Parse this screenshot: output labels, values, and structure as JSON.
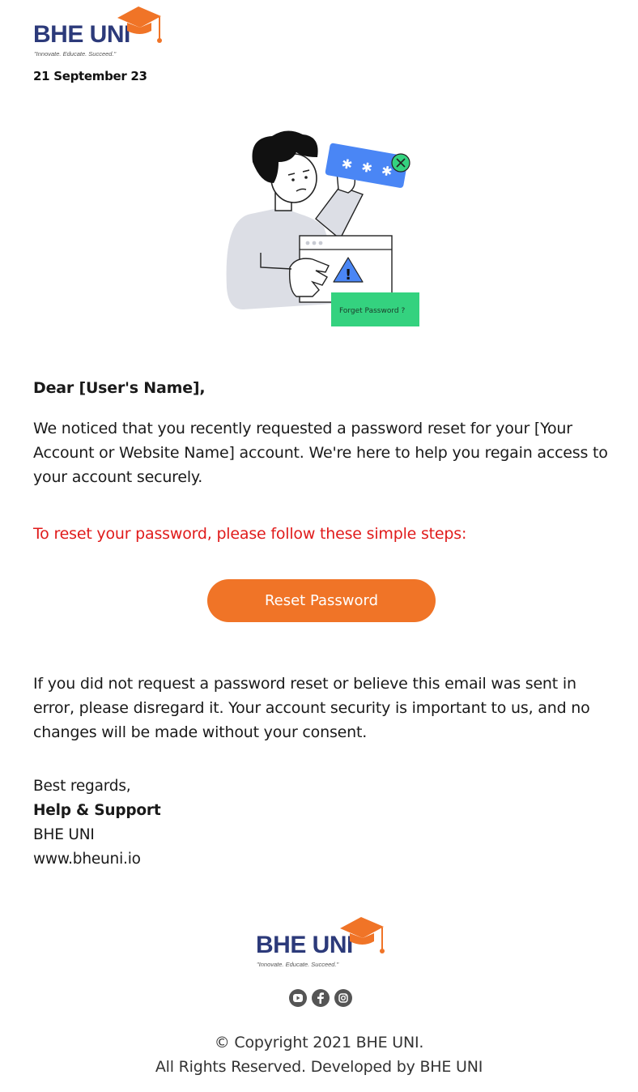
{
  "brand": {
    "name": "BHE UNI",
    "tagline": "\"Innovate. Educate. Succeed.\""
  },
  "email": {
    "date": "21 September 23",
    "illustration_label": "Forget Password ?",
    "greeting": "Dear [User's Name],",
    "intro": "We noticed that you recently requested a password reset for your [Your Account or Website Name] account. We're here to help you regain access to your account securely.",
    "steps_text": "To reset your password, please follow these simple steps:",
    "button_label": "Reset Password",
    "disclaimer": "If you did not request a password reset or believe this email was sent in error, please disregard it. Your account security is important to us, and no changes will be made without your consent."
  },
  "signature": {
    "regards": "Best regards,",
    "team": "Help & Support",
    "company": "BHE UNI",
    "website": "www.bheuni.io"
  },
  "footer": {
    "social": [
      "youtube-icon",
      "facebook-icon",
      "instagram-icon"
    ],
    "copyright": "© Copyright 2021 BHE UNI.",
    "rights": "All Rights Reserved. Developed by BHE UNI"
  },
  "colors": {
    "brand_navy": "#2c3a7a",
    "brand_orange": "#f07427",
    "alert_red": "#e01b1b",
    "illustration_blue": "#4a86f5",
    "illustration_green": "#34d27f"
  }
}
